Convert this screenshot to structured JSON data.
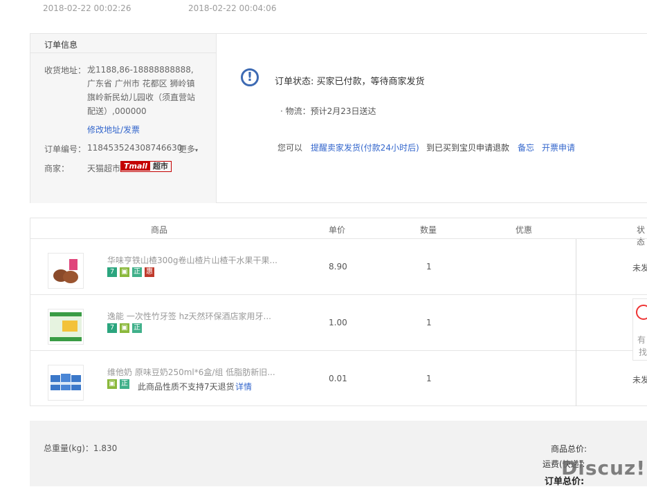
{
  "timestamps": [
    "2018-02-22 00:02:26",
    "2018-02-22 00:04:06"
  ],
  "order_info": {
    "title": "订单信息",
    "address_label": "收货地址：",
    "address_value": "龙1188,86-18888888888,广东省 广州市 花都区 狮岭镇 旗岭新民幼儿园收（须直营站配送）,000000",
    "edit_address": "修改地址/发票",
    "order_no_label": "订单编号：",
    "order_no": "118453524308746630",
    "more": "更多",
    "merchant_label": "商家：",
    "merchant": "天猫超市",
    "tmall_a": "Tmall",
    "tmall_b": "超市"
  },
  "status": {
    "icon": "!",
    "text": "订单状态: 买家已付款，等待商家发货",
    "logistics": "· 物流：预计2月23日送达",
    "you_can": "您可以",
    "actions": [
      "提醒卖家发货(付款24小时后)",
      "到已买到宝贝申请退款",
      "备忘",
      "开票申请"
    ]
  },
  "table": {
    "headers": [
      "商品",
      "单价",
      "数量",
      "优惠",
      "状态"
    ],
    "rows": [
      {
        "name": "华味亨铁山楂300g卷山楂片山楂干水果干果...",
        "price": "8.90",
        "qty": "1",
        "status": "未发"
      },
      {
        "name": "逸能 一次性竹牙签 hz天然环保酒店家用牙...",
        "price": "1.00",
        "qty": "1",
        "status": ""
      },
      {
        "name": "维他奶 原味豆奶250ml*6盒/组 低脂肪新旧...",
        "price": "0.01",
        "qty": "1",
        "status": "未发",
        "note": "此商品性质不支持7天退货",
        "note_link": "详情"
      }
    ],
    "badges": {
      "seven": "7",
      "zheng": "正",
      "hui": "惠"
    },
    "side_card": [
      "有",
      "找"
    ]
  },
  "footer": {
    "weight": "总重量(kg)：1.830",
    "goods_total": "商品总价:",
    "shipping": "运费(快递):",
    "order_total": "订单总价:"
  },
  "watermark": "Discuz!"
}
